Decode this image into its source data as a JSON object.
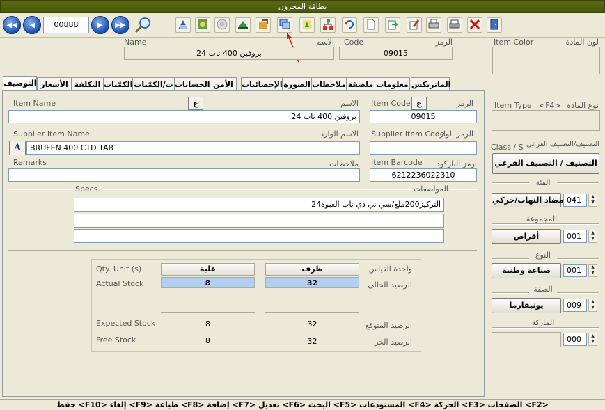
{
  "window": {
    "title": "بطاقة المخزون"
  },
  "toolbar": {
    "record_number": "00888",
    "nav": {
      "first": "first-record",
      "prev": "previous-record",
      "next": "next-record",
      "last": "last-record"
    },
    "icons": [
      "search-icon",
      "chart-icon",
      "gear-icon",
      "disabled-icon",
      "book-icon",
      "export-icon",
      "windows-icon",
      "move-icon",
      "tree-icon",
      "undo-icon",
      "new-document-icon",
      "copy-icon",
      "edit-icon",
      "printer-icon",
      "print-preview-icon",
      "delete-icon",
      "exit-door-icon"
    ]
  },
  "header": {
    "name_label_en": "Name",
    "name_label_ar": "الاسم",
    "name_value": "بروفين 400  تاب 24",
    "code_label_en": "Code",
    "code_label_ar": "الرمز",
    "code_value": "09015",
    "item_color_en": "Item Color",
    "item_color_ar": "لون المادة"
  },
  "tabs": [
    "التوصيف",
    "الأسعار",
    "التكلفة",
    "الكمّيات",
    "ت/الكمّيات",
    "الحسابات",
    "الأمن",
    "الإحصائيات",
    "الصورة",
    "ملاحظات",
    "ملصقة",
    "معلومات",
    "الماتريكس"
  ],
  "description": {
    "item_name_en": "Item Name",
    "item_name_ar": "الاسم",
    "item_name_value": "بروفين 400  تاب 24",
    "item_code_en": "Item Code",
    "item_code_ar": "الرمز",
    "item_code_value": "09015",
    "lang_toggle": "ع",
    "supplier_name_en": "Supplier Item Name",
    "supplier_name_ar": "الاسم الوارد",
    "supplier_name_value": "BRUFEN 400 CTD TAB",
    "supplier_name_btn": "A",
    "supplier_code_en": "Supplier Item Code",
    "supplier_code_ar": "الرمز الوارد",
    "supplier_code_value": "",
    "remarks_en": "Remarks",
    "remarks_ar": "ملاحظات",
    "remarks_value": "",
    "barcode_en": "Item Barcode",
    "barcode_ar": "رمز الباركود",
    "barcode_value": "6212236022310",
    "specs_en": "Specs.",
    "specs_ar": "المواصفات",
    "specs_lines": [
      "التركيز200ملغ/سي تي دي تاب العبوة24",
      "",
      ""
    ]
  },
  "stock": {
    "qty_unit_en": "Qty. Unit (s)",
    "qty_unit_ar": "واحدة القياس",
    "unit_1": "علبة",
    "unit_2": "ظرف",
    "actual_en": "Actual Stock",
    "actual_ar": "الرصيد الحالى",
    "actual_1": "8",
    "actual_2": "32",
    "expected_en": "Expected Stock",
    "expected_ar": "الرصيد المتوقع",
    "expected_1": "8",
    "expected_2": "32",
    "free_en": "Free Stock",
    "free_ar": "الرصيد الحر",
    "free_1": "8",
    "free_2": "32"
  },
  "right_panel": {
    "item_type_en": "Item Type",
    "item_type_key": "<F4>",
    "item_type_ar": "نوع المادة",
    "class_en": "Class / S",
    "class_ar": "التصنيف/التصنيف الفرعي",
    "class_button": "التصنيف / التصنيف الفرعي",
    "category_title": "الفئة",
    "category_code": "041",
    "category_button": "مضاد التهاب/حركي",
    "group_title": "المجموعة",
    "group_code": "001",
    "group_button": "أقراص",
    "type_title": "النوع",
    "type_code": "001",
    "type_button": "صناعة وطنية",
    "manufacturer_title": "الصفة",
    "manufacturer_code": "009",
    "manufacturer_button": "يونيفارما",
    "brand_title": "الماركة",
    "brand_code": "000"
  },
  "statusbar": {
    "text": "<F2> الصفحات  <F3> الحركة  <F4>  المستودعات  <F5> البحث  <F6> تعديل  <F7> إضافة  <F8> طباعة  <F9> إلغاء  <F10> حفظ"
  },
  "colors": {
    "title_bar": "#4f5f10",
    "highlight": "#b4cef0",
    "annotation_arrow": "#e01010"
  }
}
